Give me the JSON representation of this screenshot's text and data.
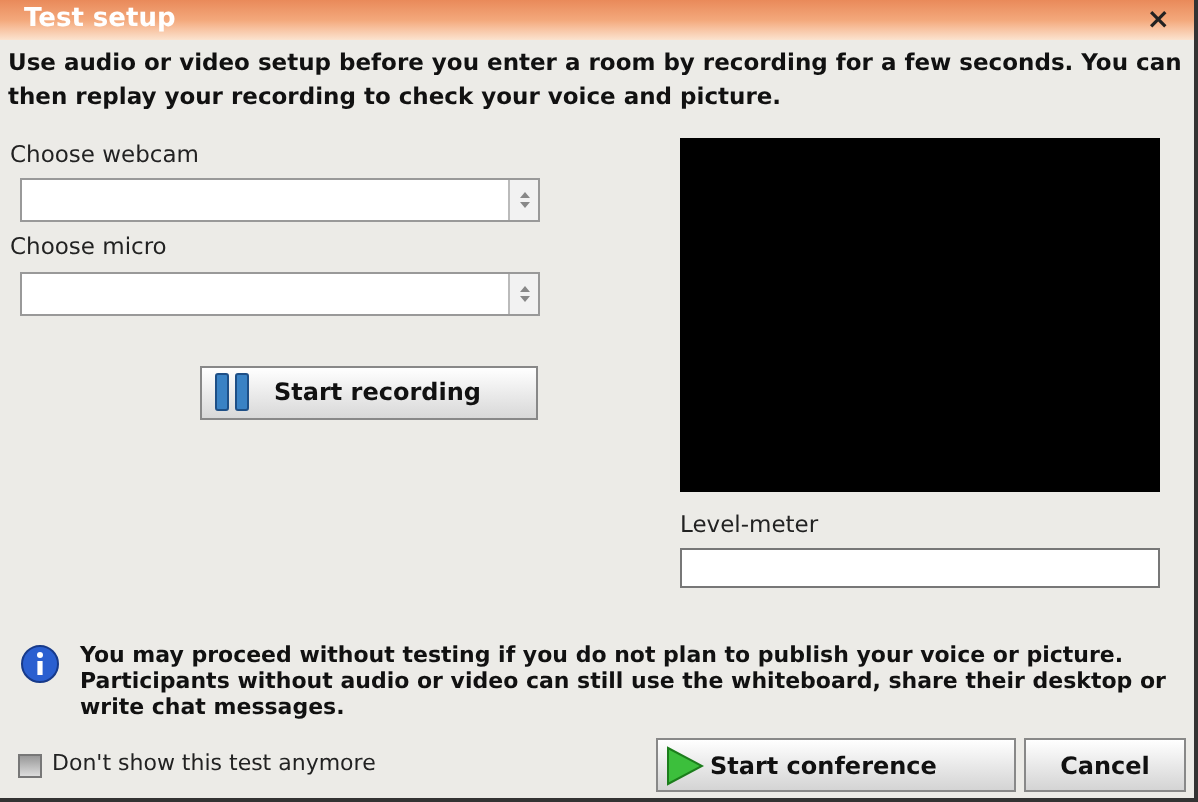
{
  "window": {
    "title": "Test setup",
    "close": "×"
  },
  "intro": "Use audio or video setup before you enter a room by recording for a few seconds. You can then replay your recording to check your voice and picture.",
  "webcam": {
    "label": "Choose webcam"
  },
  "micro": {
    "label": "Choose micro"
  },
  "record_button": "Start recording",
  "level_meter": {
    "label": "Level-meter"
  },
  "info": "You may proceed without testing if you do not plan to publish your voice or picture. Participants without audio or video can still use the whiteboard, share their desktop or write chat messages.",
  "dont_show": {
    "label": "Don't show this test anymore",
    "checked": false
  },
  "buttons": [
    {
      "kind": "start",
      "label": "Start conference"
    },
    {
      "kind": "cancel",
      "label": "Cancel"
    }
  ]
}
